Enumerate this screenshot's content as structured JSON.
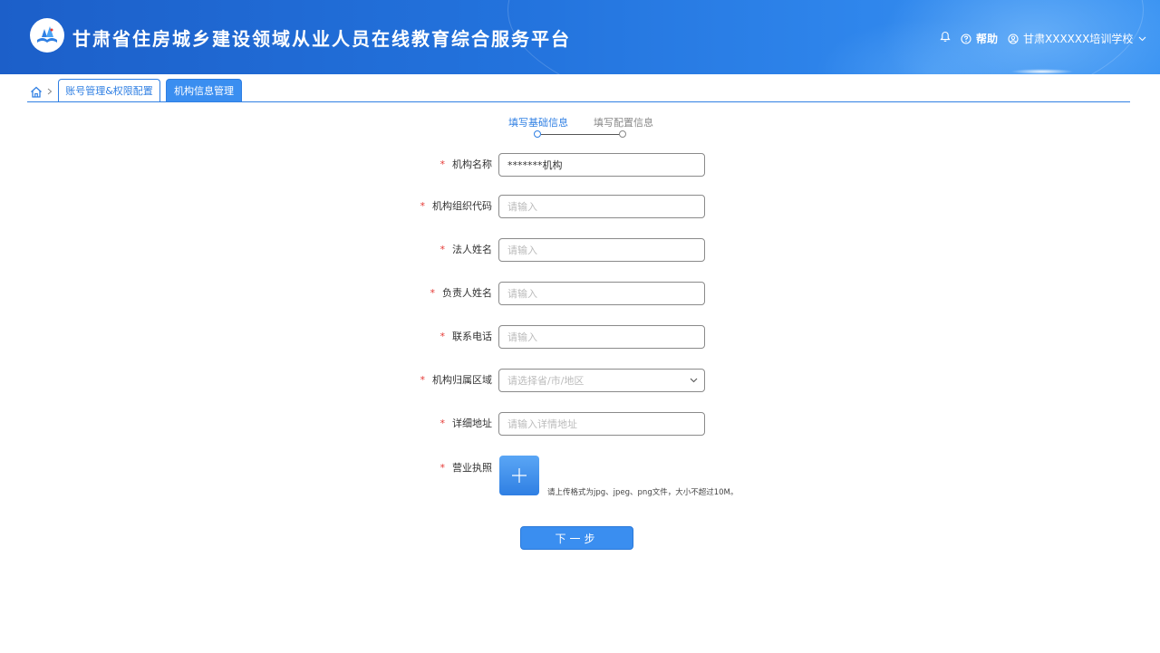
{
  "header": {
    "title": "甘肃省住房城乡建设领域从业人员在线教育综合服务平台",
    "help_label": "帮助",
    "user_name": "甘肃XXXXXX培训学校",
    "icons": [
      "logo-icon",
      "bell-icon",
      "help-icon",
      "user-icon",
      "chevron-down-icon"
    ]
  },
  "tabs": {
    "items": [
      {
        "label": "账号管理&权限配置",
        "active": false
      },
      {
        "label": "机构信息管理",
        "active": true
      }
    ]
  },
  "steps": [
    {
      "label": "填写基础信息",
      "active": true
    },
    {
      "label": "填写配置信息",
      "active": false
    }
  ],
  "form": {
    "required_mark": "*",
    "fields": [
      {
        "label": "机构名称",
        "value": "*******机构",
        "placeholder": ""
      },
      {
        "label": "机构组织代码",
        "value": "",
        "placeholder": "请输入"
      },
      {
        "label": "法人姓名",
        "value": "",
        "placeholder": "请输入"
      },
      {
        "label": "负责人姓名",
        "value": "",
        "placeholder": "请输入"
      },
      {
        "label": "联系电话",
        "value": "",
        "placeholder": "请输入"
      },
      {
        "label": "机构归属区域",
        "value": "",
        "placeholder": "请选择省/市/地区",
        "type": "select"
      },
      {
        "label": "详细地址",
        "value": "",
        "placeholder": "请输入详情地址"
      },
      {
        "label": "营业执照",
        "type": "upload"
      }
    ],
    "upload_hint": "请上传格式为jpg、jpeg、png文件，大小不超过10M。",
    "next_label": "下一步"
  },
  "colors": {
    "primary": "#2f7fe3",
    "header_dark": "#1c5fc9",
    "required": "#e53935"
  }
}
